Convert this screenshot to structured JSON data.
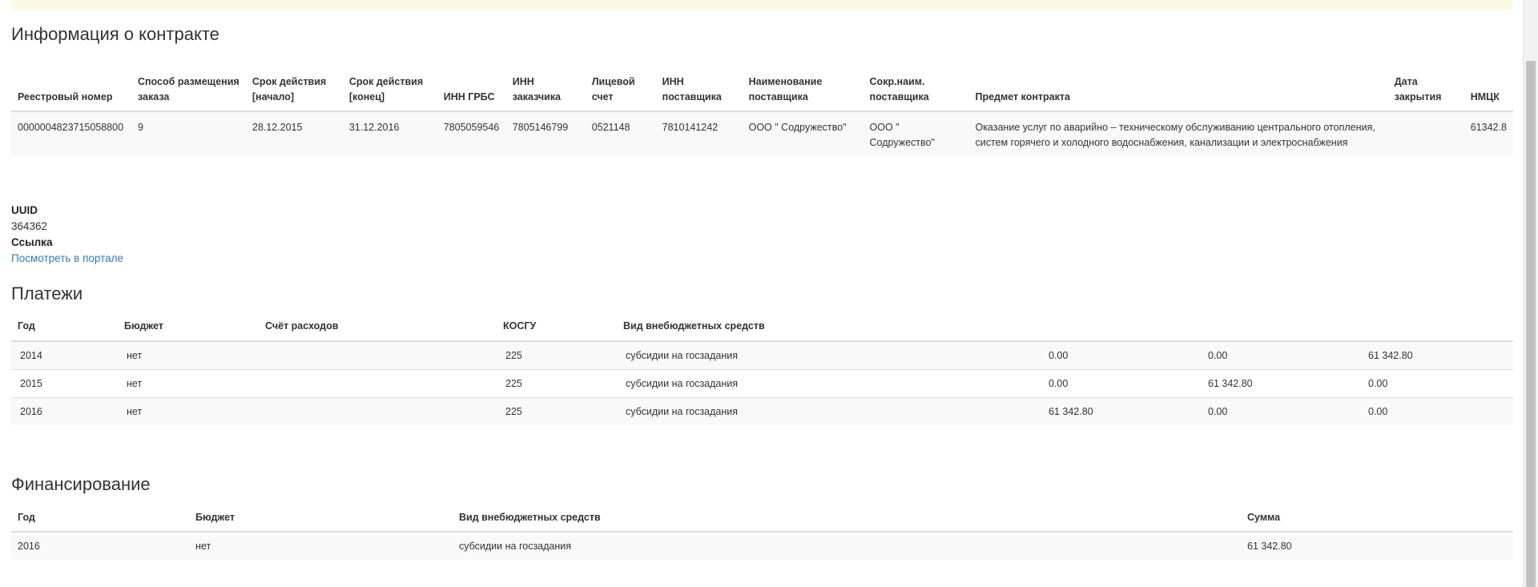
{
  "contract": {
    "title": "Информация о контракте",
    "headers": [
      "Реестровый номер",
      "Способ размещения заказа",
      "Срок действия [начало]",
      "Срок действия [конец]",
      "ИНН ГРБС",
      "ИНН заказчика",
      "Лицевой счет",
      "ИНН поставщика",
      "Наименование поставщика",
      "Сокр.наим. поставщика",
      "Предмет контракта",
      "Дата закрытия",
      "НМЦК"
    ],
    "row": [
      "0000004823715058800",
      "9",
      "28.12.2015",
      "31.12.2016",
      "7805059546",
      "7805146799",
      "0521148",
      "7810141242",
      "ООО \" Содружество\"",
      "ООО \" Содружество\"",
      "Оказание услуг по аварийно – техническому обслуживанию центрального отопления, систем горячего и холодного водоснабжения, канализации и электроснабжения",
      "",
      "61342.8"
    ]
  },
  "meta": {
    "uuid_label": "UUID",
    "uuid_value": "364362",
    "link_label": "Ссылка",
    "link_text": "Посмотреть в портале"
  },
  "payments": {
    "title": "Платежи",
    "headers": [
      "Год",
      "Бюджет",
      "Счёт расходов",
      "КОСГУ",
      "Вид внебюджетных средств",
      "",
      "",
      ""
    ],
    "rows": [
      [
        "2014",
        "нет",
        "",
        "225",
        "субсидии на госзадания",
        "0.00",
        "0.00",
        "61 342.80"
      ],
      [
        "2015",
        "нет",
        "",
        "225",
        "субсидии на госзадания",
        "0.00",
        "61 342.80",
        "0.00"
      ],
      [
        "2016",
        "нет",
        "",
        "225",
        "субсидии на госзадания",
        "61 342.80",
        "0.00",
        "0.00"
      ]
    ]
  },
  "financing": {
    "title": "Финансирование",
    "headers": [
      "Год",
      "Бюджет",
      "Вид внебюджетных средств",
      "Сумма"
    ],
    "rows": [
      [
        "2016",
        "нет",
        "субсидии на госзадания",
        "61 342.80"
      ]
    ]
  }
}
